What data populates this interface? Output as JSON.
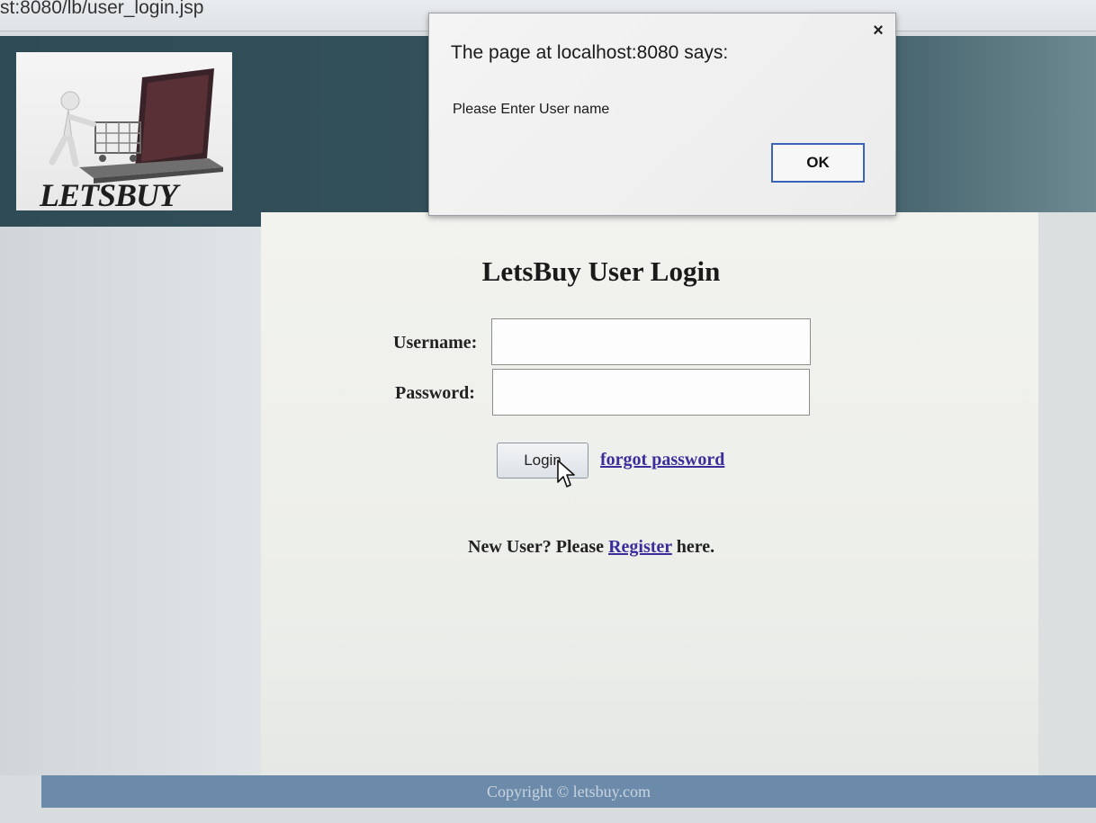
{
  "browser": {
    "url": "st:8080/lb/user_login.jsp"
  },
  "header": {
    "logo_text": "LETSBUY"
  },
  "login": {
    "title": "LetsBuy User Login",
    "username_label": "Username:",
    "password_label": "Password:",
    "username_value": "",
    "password_value": "",
    "login_button": "Login",
    "forgot_link": "forgot password",
    "new_user_prefix": "New User? Please",
    "register_link": "Register",
    "new_user_suffix": "here."
  },
  "footer": {
    "copyright": "Copyright © letsbuy.com"
  },
  "alert": {
    "title": "The page at localhost:8080 says:",
    "message": "Please Enter User name",
    "ok_button": "OK",
    "close_symbol": "×"
  },
  "icons": {
    "logo": "shopping-cart-laptop-logo",
    "cursor": "mouse-pointer-icon",
    "close": "close-icon"
  }
}
